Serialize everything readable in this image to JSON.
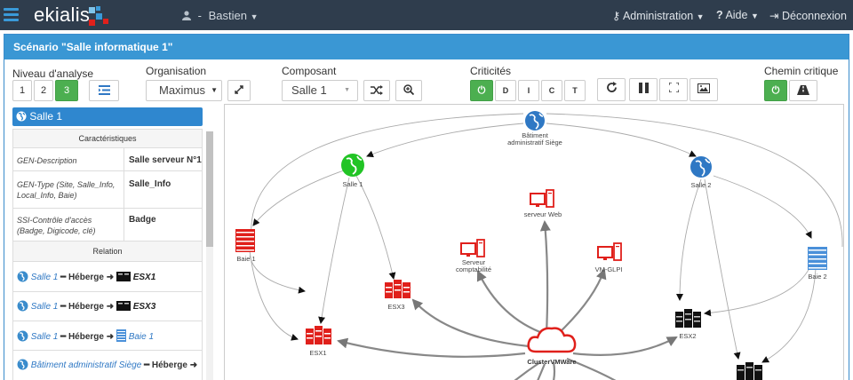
{
  "navbar": {
    "brand": "ekialis",
    "user_separator": "-",
    "user_name": "Bastien",
    "administration": "Administration",
    "aide": "Aide",
    "deconnexion": "Déconnexion"
  },
  "panel": {
    "title": "Scénario \"Salle informatique 1\""
  },
  "toolbar": {
    "niveau_label": "Niveau d'analyse",
    "niveau_buttons": [
      "1",
      "2",
      "3"
    ],
    "organisation_label": "Organisation",
    "organisation_value": "Maximus",
    "composant_label": "Composant",
    "composant_value": "Salle 1",
    "criticites_label": "Criticités",
    "criticites_buttons": [
      "D",
      "I",
      "C",
      "T"
    ],
    "chemin_label": "Chemin critique"
  },
  "sidebar": {
    "selected": "Salle 1",
    "characteristics_header": "Caractéristiques",
    "characteristics": [
      {
        "key": "GEN-Description",
        "value": "Salle serveur N°1"
      },
      {
        "key": "GEN-Type (Site, Salle_Info, Local_Info, Baie)",
        "value": "Salle_Info"
      },
      {
        "key": "SSI-Contrôle d'accès (Badge, Digicode, clé)",
        "value": "Badge"
      }
    ],
    "relation_header": "Relation",
    "relations": [
      {
        "source": "Salle 1",
        "verb": "Héberge",
        "target": "ESX1"
      },
      {
        "source": "Salle 1",
        "verb": "Héberge",
        "target": "ESX3"
      },
      {
        "source": "Salle 1",
        "verb": "Héberge",
        "target": "Baie 1"
      },
      {
        "source": "Bâtiment administratif Siège",
        "verb": "Héberge",
        "target": ""
      }
    ]
  },
  "graph": {
    "nodes": {
      "batiment_line1": "Bâtiment",
      "batiment_line2": "administratif Siège",
      "salle1": "Salle 1",
      "salle2": "Salle 2",
      "baie1": "Baie 1",
      "baie2": "Baie 2",
      "serveur_web": "serveur Web",
      "serveur_compta_line1": "Serveur",
      "serveur_compta_line2": "comptabilité",
      "vm_glpi": "VM-GLPI",
      "esx1": "ESX1",
      "esx2": "ESX2",
      "esx3": "ESX3",
      "cluster": "ClusterVMWare"
    }
  },
  "colors": {
    "navbar": "#2f3d4d",
    "panel_header": "#3a97d4",
    "active_green": "#4caf50",
    "critical_red": "#e0201b",
    "globe_blue": "#2f78c4"
  }
}
